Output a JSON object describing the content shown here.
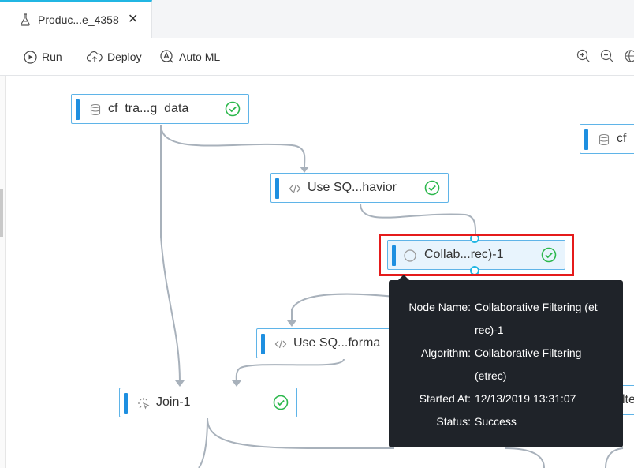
{
  "tab": {
    "title": "Produc...e_4358",
    "close_label": "✕",
    "icon": "flask-icon"
  },
  "toolbar": {
    "run_label": "Run",
    "deploy_label": "Deploy",
    "automl_label": "Auto ML",
    "zoom_icons": [
      "zoom-in-icon",
      "zoom-out-icon",
      "globe-icon"
    ]
  },
  "nodes": {
    "cf_training": {
      "label": "cf_tra...g_data",
      "icon": "database-icon",
      "status": "success"
    },
    "cf_partial": {
      "label": "cf_",
      "icon": "database-icon"
    },
    "use_sql_behavior": {
      "label": "Use SQ...havior",
      "icon": "code-icon",
      "status": "success"
    },
    "collab": {
      "label": "Collab...rec)-1",
      "icon": "circle-icon",
      "status": "success"
    },
    "use_sql_format": {
      "label": "Use SQ...forma",
      "icon": "code-icon"
    },
    "join": {
      "label": "Join-1",
      "icon": "join-icon",
      "status": "success"
    },
    "partial_right": {
      "label": "lte"
    }
  },
  "tooltip": {
    "node_name_key": "Node Name:",
    "node_name_line1": "Collaborative Filtering (et",
    "node_name_line2": "rec)-1",
    "algorithm_key": "Algorithm:",
    "algorithm_line1": "Collaborative Filtering",
    "algorithm_line2": "(etrec)",
    "started_key": "Started At:",
    "started_val": "12/13/2019 13:31:07",
    "status_key": "Status:",
    "status_val": "Success"
  },
  "colors": {
    "accent": "#1e8fe0",
    "node_border": "#5fb4e8",
    "success": "#2db84d",
    "highlight": "#e51b1b",
    "tooltip_bg": "#1f2329"
  }
}
